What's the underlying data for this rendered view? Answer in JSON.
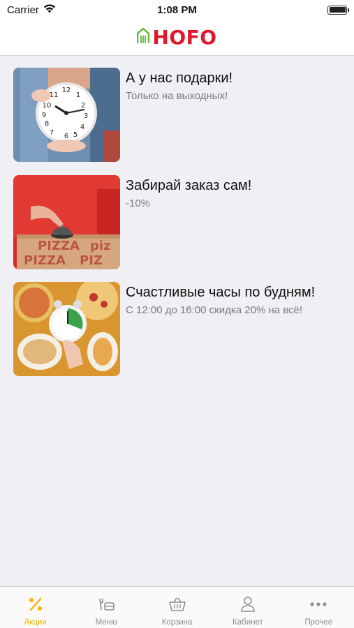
{
  "status_bar": {
    "carrier": "Carrier",
    "time": "1:08 PM",
    "wifi_icon": "wifi-icon",
    "battery_icon": "battery-icon"
  },
  "header": {
    "logo_text": "HOFO",
    "logo_icon": "fork-house-icon",
    "brand_color": "#e1172b",
    "icon_color": "#5cb531"
  },
  "promos": [
    {
      "title": "А у нас подарки!",
      "subtitle": "Только на выходных!",
      "image": "clock-photo"
    },
    {
      "title": "Забирай заказ сам!",
      "subtitle": "-10%",
      "image": "pizza-box-bell-photo"
    },
    {
      "title": "Счастливые часы по будням!",
      "subtitle": "С 12:00 до 16:00 скидка 20% на всё!",
      "image": "timer-pizza-photo"
    }
  ],
  "tab_bar": {
    "active_color": "#f4b400",
    "tabs": [
      {
        "label": "Акции",
        "icon": "percent-icon",
        "active": true
      },
      {
        "label": "Меню",
        "icon": "menu-icon",
        "active": false
      },
      {
        "label": "Корзина",
        "icon": "basket-icon",
        "active": false
      },
      {
        "label": "Кабинет",
        "icon": "user-icon",
        "active": false
      },
      {
        "label": "Прочее",
        "icon": "more-icon",
        "active": false
      }
    ]
  }
}
